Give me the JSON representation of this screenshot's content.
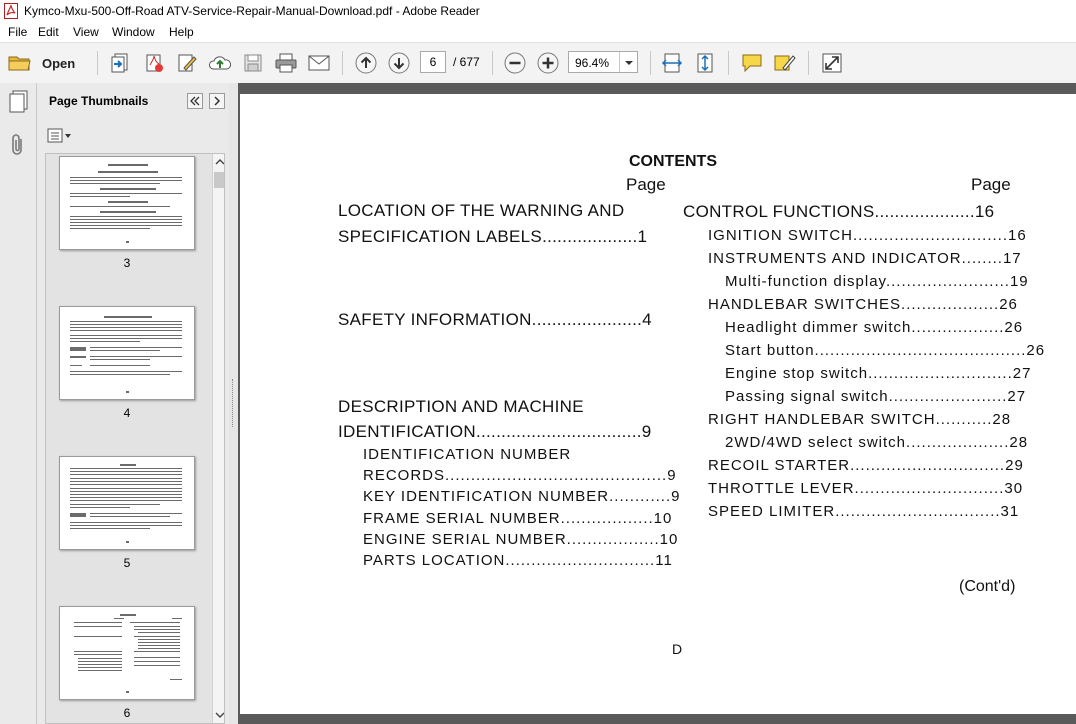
{
  "window": {
    "title": "Kymco-Mxu-500-Off-Road ATV-Service-Repair-Manual-Download.pdf - Adobe Reader"
  },
  "menu": [
    "File",
    "Edit",
    "View",
    "Window",
    "Help"
  ],
  "toolbar": {
    "open_label": "Open",
    "page_current": "6",
    "page_total": "/ 677",
    "zoom": "96.4%"
  },
  "sidebar": {
    "title": "Page Thumbnails",
    "thumbnails": [
      "3",
      "4",
      "5",
      "6"
    ]
  },
  "document": {
    "heading": "CONTENTS",
    "page_label_left": "Page",
    "page_label_right": "Page",
    "left": [
      {
        "text": "LOCATION OF THE WARNING AND"
      },
      {
        "text": "SPECIFICATION  LABELS...................1"
      },
      {
        "text": "SAFETY INFORMATION......................4"
      },
      {
        "text": "DESCRIPTION AND MACHINE"
      },
      {
        "text": "IDENTIFICATION.................................9"
      },
      {
        "text": "IDENTIFICATION  NUMBER"
      },
      {
        "text": "RECORDS...........................................9"
      },
      {
        "text": "KEY IDENTIFICATION NUMBER............9"
      },
      {
        "text": "FRAME SERIAL NUMBER..................10"
      },
      {
        "text": "ENGINE SERIAL NUMBER..................10"
      },
      {
        "text": "PARTS   LOCATION.............................11"
      }
    ],
    "right": [
      {
        "text": "CONTROL FUNCTIONS....................16"
      },
      {
        "text": "IGNITION SWITCH..............................16"
      },
      {
        "text": "INSTRUMENTS AND INDICATOR........17"
      },
      {
        "text": "Multi-function display........................19"
      },
      {
        "text": "HANDLEBAR SWITCHES...................26"
      },
      {
        "text": "Headlight dimmer switch..................26"
      },
      {
        "text": "Start  button.........................................26"
      },
      {
        "text": "Engine stop switch............................27"
      },
      {
        "text": "Passing signal switch.......................27"
      },
      {
        "text": "RIGHT   HANDLEBAR   SWITCH...........28"
      },
      {
        "text": "2WD/4WD select switch....................28"
      },
      {
        "text": "RECOIL STARTER..............................29"
      },
      {
        "text": "THROTTLE  LEVER.............................30"
      },
      {
        "text": "SPEED  LIMITER................................31"
      }
    ],
    "contd": "(Cont'd)",
    "footer": "D"
  }
}
